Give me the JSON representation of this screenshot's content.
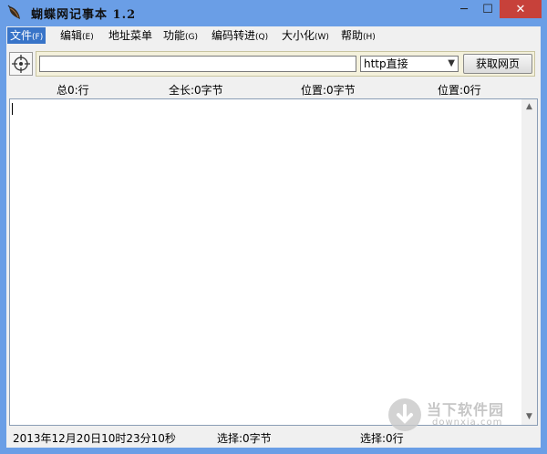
{
  "window": {
    "title": "蝴蝶网记事本 1.2",
    "minimize_glyph": "─",
    "maximize_glyph": "☐",
    "close_glyph": "✕"
  },
  "menu": [
    {
      "label": "文件",
      "key": "(F)"
    },
    {
      "label": "编辑",
      "key": "(E)"
    },
    {
      "label": "地址菜单",
      "key": ""
    },
    {
      "label": "功能",
      "key": "(G)"
    },
    {
      "label": "编码转进",
      "key": "(Q)"
    },
    {
      "label": "大小化",
      "key": "(W)"
    },
    {
      "label": "帮助",
      "key": "(H)"
    }
  ],
  "toolbar": {
    "url_value": "",
    "protocol_selected": "http直接",
    "fetch_label": "获取网页"
  },
  "stats": {
    "total_lines": "总0:行",
    "total_length": "全长:0字节",
    "position_bytes": "位置:0字节",
    "position_lines": "位置:0行"
  },
  "editor": {
    "content": ""
  },
  "watermark": {
    "text": "当下软件园",
    "url": "downxia.com"
  },
  "footer": {
    "timestamp": "2013年12月20日10时23分10秒",
    "selection_bytes": "选择:0字节",
    "selection_lines": "选择:0行"
  },
  "colors": {
    "frame": "#6a9ee6",
    "close": "#c7413a",
    "menu_highlight": "#3874c8",
    "address_panel": "#f4f1dc"
  }
}
